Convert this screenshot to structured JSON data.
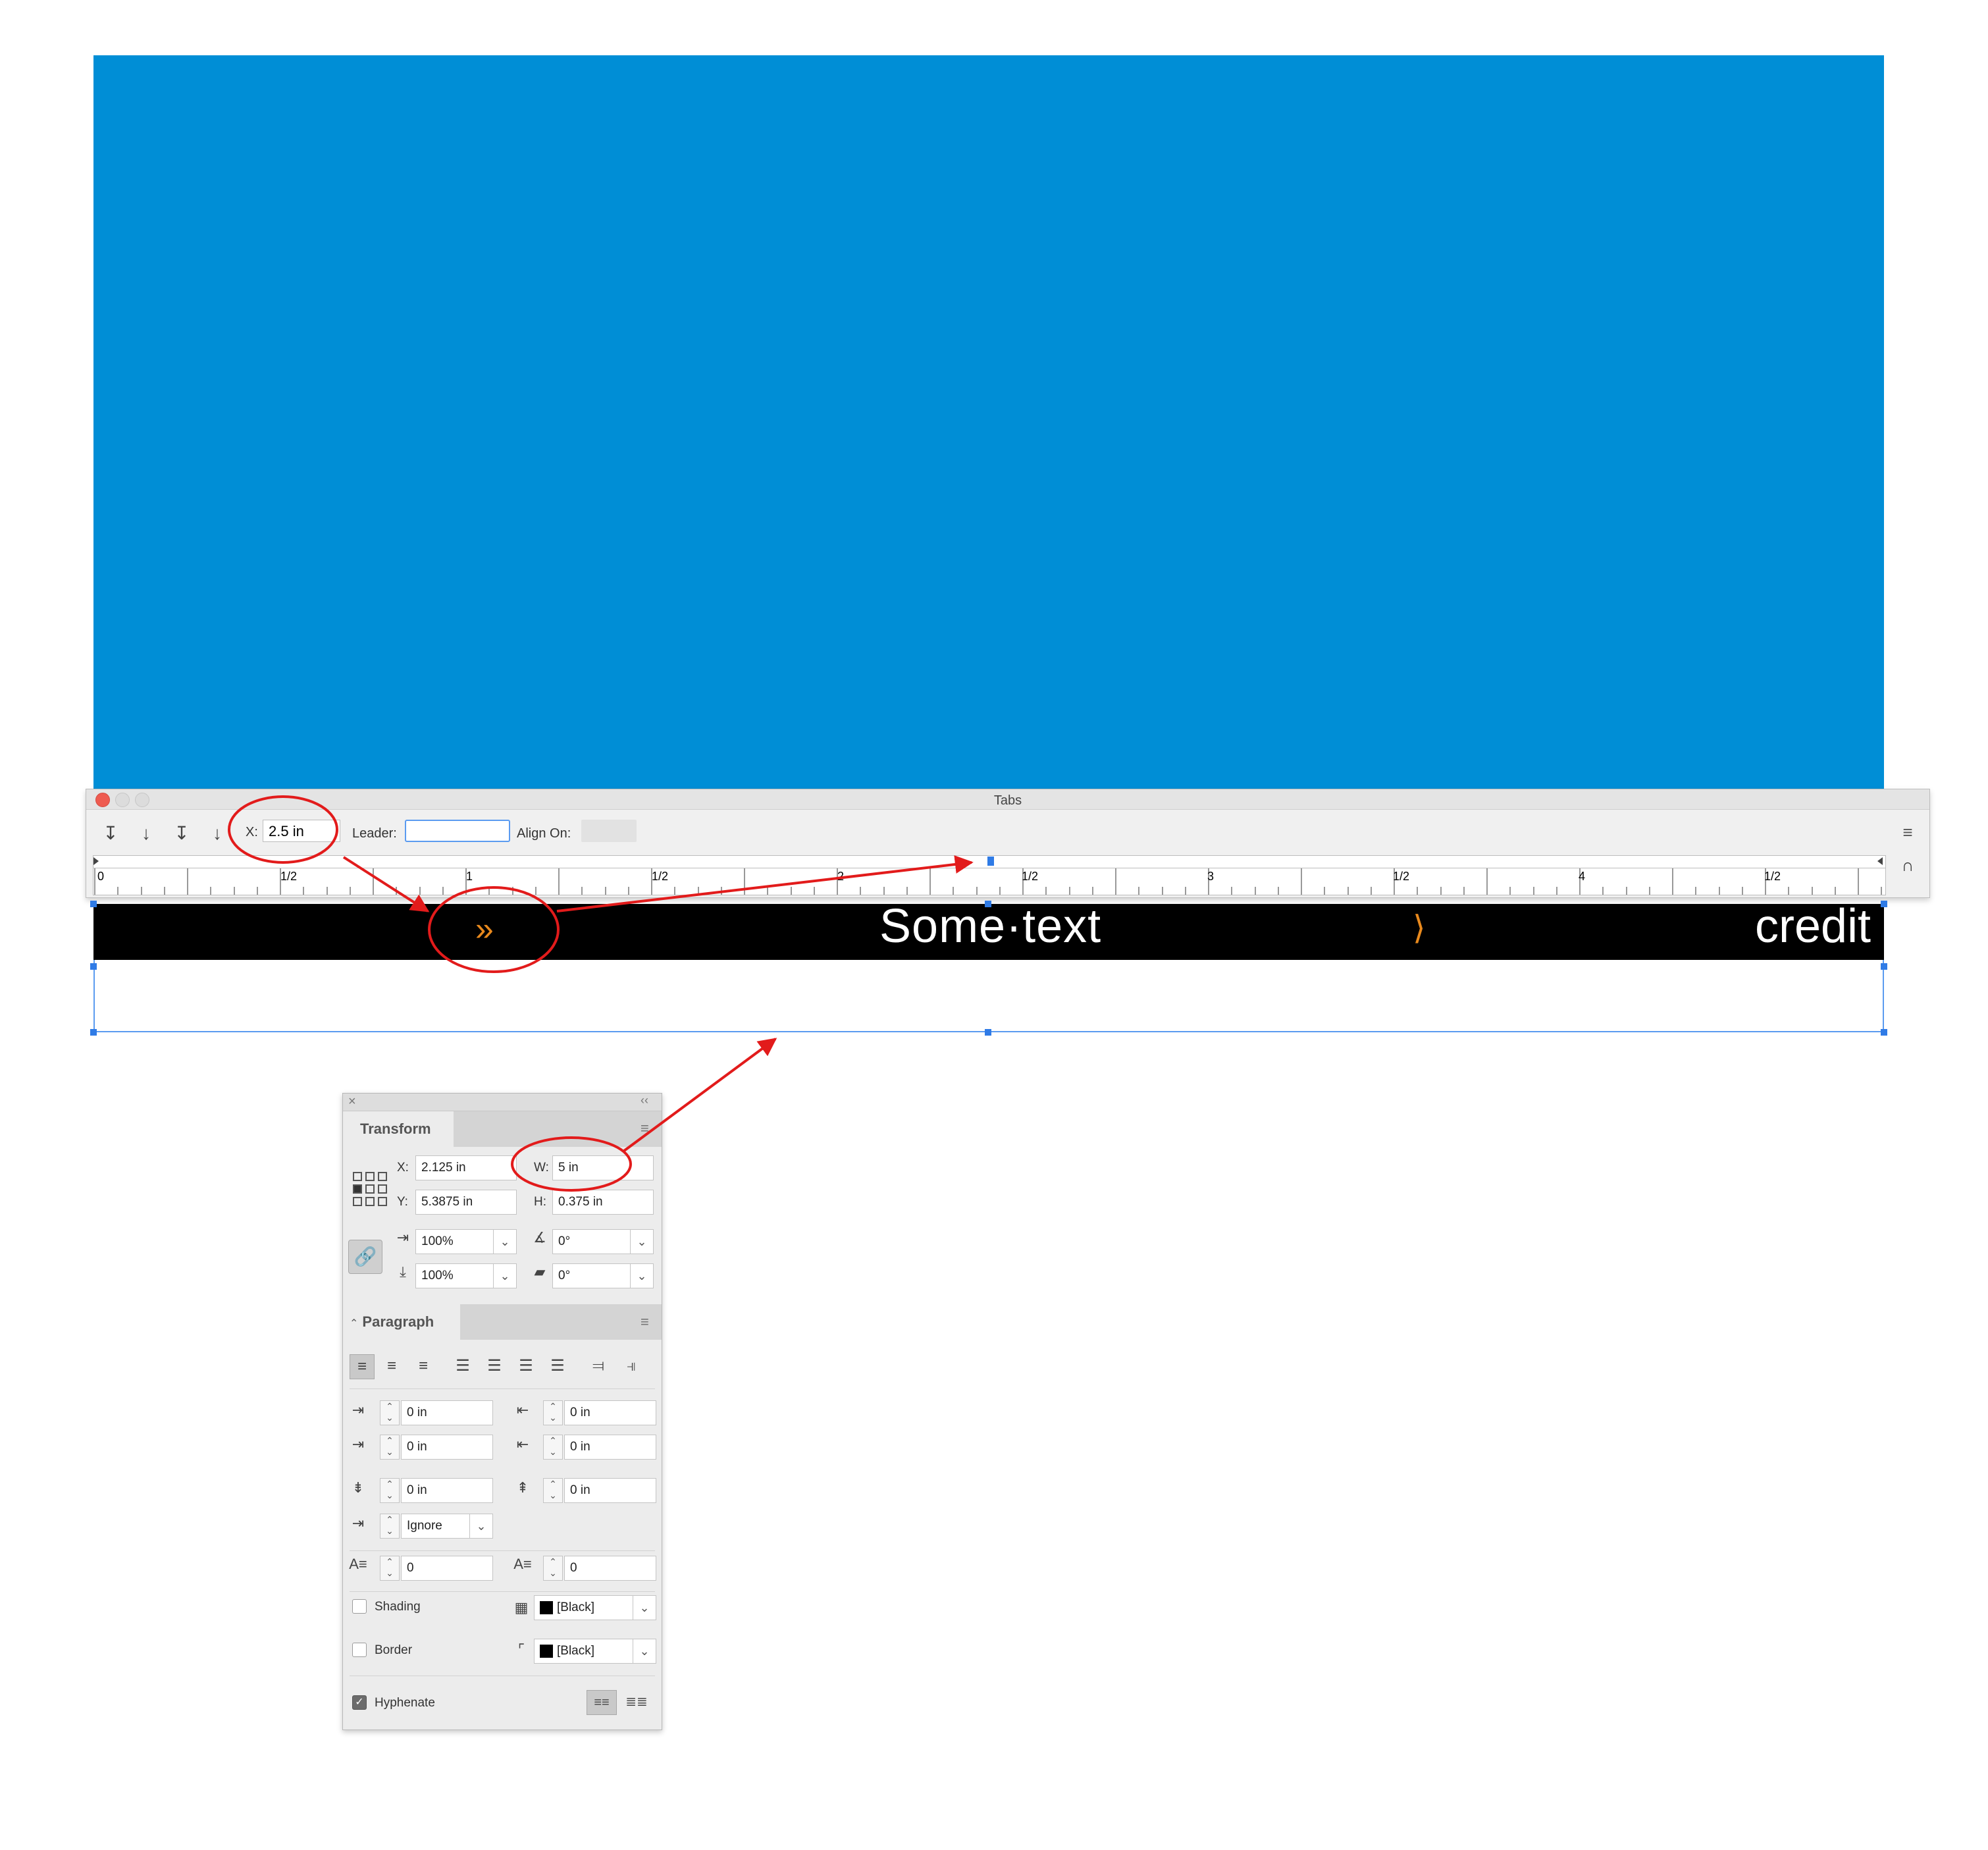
{
  "tabs_panel": {
    "title": "Tabs",
    "x_label": "X:",
    "x_value": "2.5 in",
    "leader_label": "Leader:",
    "leader_value": "",
    "align_on_label": "Align On:",
    "align_on_value": "",
    "ruler_labels": [
      "0",
      "1/2",
      "1",
      "1/2",
      "2",
      "1/2",
      "3",
      "1/2",
      "4",
      "1/2"
    ],
    "tab_buttons": [
      "left-justified-tab-icon",
      "center-justified-tab-icon",
      "right-justified-tab-icon",
      "align-to-decimal-tab-icon"
    ]
  },
  "text_frame": {
    "main_text": "Some·text",
    "right_text": "credit",
    "tab_marker": "»"
  },
  "transform_panel": {
    "title": "Transform",
    "x_label": "X:",
    "x_value": "2.125 in",
    "y_label": "Y:",
    "y_value": "5.3875 in",
    "w_label": "W:",
    "w_value": "5 in",
    "h_label": "H:",
    "h_value": "0.375 in",
    "scale_x": "100%",
    "scale_y": "100%",
    "rotation": "0°",
    "shear": "0°"
  },
  "paragraph_panel": {
    "title": "Paragraph",
    "left_indent": "0 in",
    "right_indent": "0 in",
    "first_line_indent": "0 in",
    "last_line_right_indent": "0 in",
    "space_before": "0 in",
    "space_after": "0 in",
    "align_to_grid": "Ignore",
    "drop_cap_lines": "0",
    "drop_cap_chars": "0",
    "shading_label": "Shading",
    "shading_swatch": "[Black]",
    "border_label": "Border",
    "border_swatch": "[Black]",
    "hyphenate_label": "Hyphenate",
    "hyphenate_checked": true
  },
  "colors": {
    "canvas_blue": "#008ed6",
    "annotation_red": "#e21b1b",
    "tab_marker_orange": "#e8891d",
    "selection_blue": "#2f7be6"
  }
}
